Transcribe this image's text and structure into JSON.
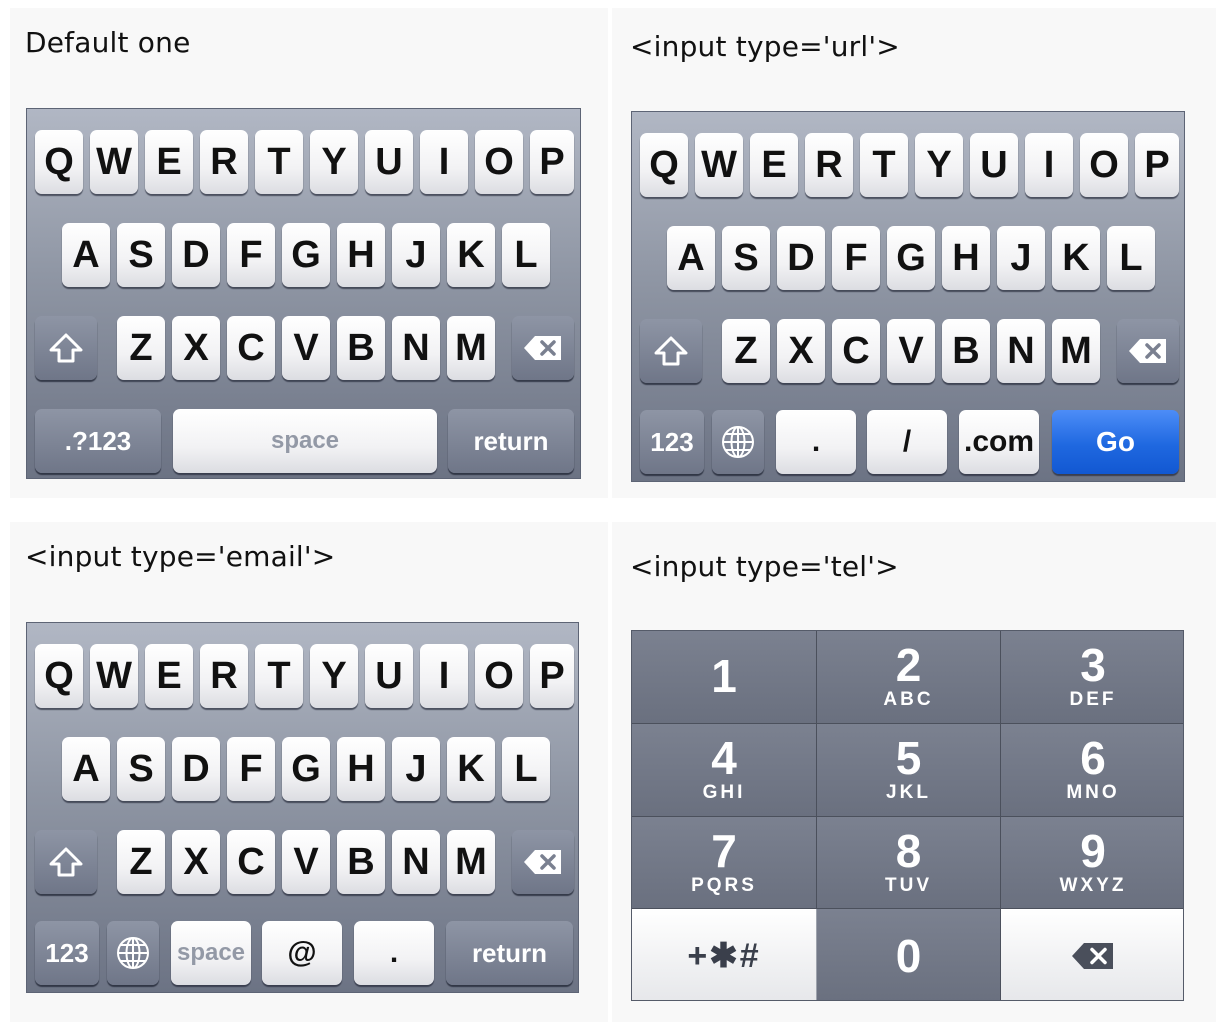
{
  "captions": {
    "default": "Default one",
    "url": "<input type='url'>",
    "email": "<input type='email'>",
    "tel": "<input type='tel'>"
  },
  "letters": {
    "row1": [
      "Q",
      "W",
      "E",
      "R",
      "T",
      "Y",
      "U",
      "I",
      "O",
      "P"
    ],
    "row2": [
      "A",
      "S",
      "D",
      "F",
      "G",
      "H",
      "J",
      "K",
      "L"
    ],
    "row3": [
      "Z",
      "X",
      "C",
      "V",
      "B",
      "N",
      "M"
    ]
  },
  "default_kb": {
    "numbers": ".?123",
    "space": "space",
    "return": "return"
  },
  "url_kb": {
    "numbers": "123",
    "dot": ".",
    "slash": "/",
    "dotcom": ".com",
    "go": "Go"
  },
  "email_kb": {
    "numbers": "123",
    "space": "space",
    "at": "@",
    "dot": ".",
    "return": "return"
  },
  "tel_kb": {
    "keys": [
      {
        "digit": "1",
        "letters": ""
      },
      {
        "digit": "2",
        "letters": "ABC"
      },
      {
        "digit": "3",
        "letters": "DEF"
      },
      {
        "digit": "4",
        "letters": "GHI"
      },
      {
        "digit": "5",
        "letters": "JKL"
      },
      {
        "digit": "6",
        "letters": "MNO"
      },
      {
        "digit": "7",
        "letters": "PQRS"
      },
      {
        "digit": "8",
        "letters": "TUV"
      },
      {
        "digit": "9",
        "letters": "WXYZ"
      }
    ],
    "symbols": "+✱#",
    "zero": "0"
  },
  "icons": {
    "shift": "shift-arrow-icon",
    "delete": "backspace-icon",
    "globe": "globe-icon"
  },
  "colors": {
    "go_button": "#1f68e0",
    "keyboard_bg": "#8f96a4"
  }
}
